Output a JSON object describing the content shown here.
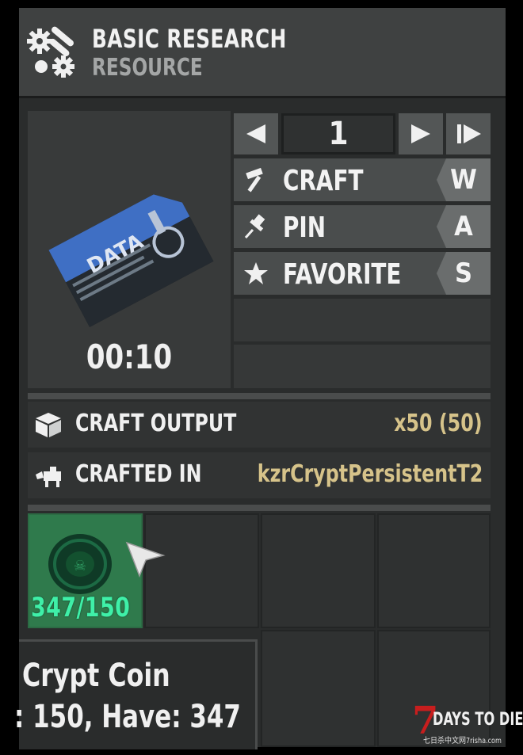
{
  "header": {
    "title": "BASIC RESEARCH",
    "subtitle": "RESOURCE",
    "icon": "gears-pipes-icon"
  },
  "recipe": {
    "image_label": "DATA",
    "image_icon": "data-card-icon",
    "craft_time": "00:10"
  },
  "quantity": {
    "value": "1",
    "decrease_icon": "triangle-left-icon",
    "increase_icon": "triangle-right-icon",
    "max_icon": "skip-to-max-icon"
  },
  "actions": [
    {
      "label": "CRAFT",
      "key": "W",
      "icon": "hammer-icon"
    },
    {
      "label": "PIN",
      "key": "A",
      "icon": "pin-icon"
    },
    {
      "label": "FAVORITE",
      "key": "S",
      "icon": "star-icon"
    }
  ],
  "info": {
    "output_label": "CRAFT OUTPUT",
    "output_value": "x50 (50)",
    "output_icon": "box-icon",
    "station_label": "CRAFTED IN",
    "station_value": "kzrCryptPersistentT2",
    "station_icon": "workbench-hand-icon"
  },
  "ingredients": [
    {
      "name": "Crypt Coin",
      "count": "347/150",
      "icon": "crypt-coin-icon"
    }
  ],
  "tooltip": {
    "name": "Crypt Coin",
    "counts": ": 150, Have: 347"
  },
  "watermark": {
    "seven": "7",
    "title": "DAYS TO DIE",
    "subtitle": "七日杀中文网7risha.com"
  },
  "colors": {
    "accent_green": "#3ff0a8",
    "value_gold": "#d6c38a",
    "slot_active": "#2f7a4c"
  }
}
